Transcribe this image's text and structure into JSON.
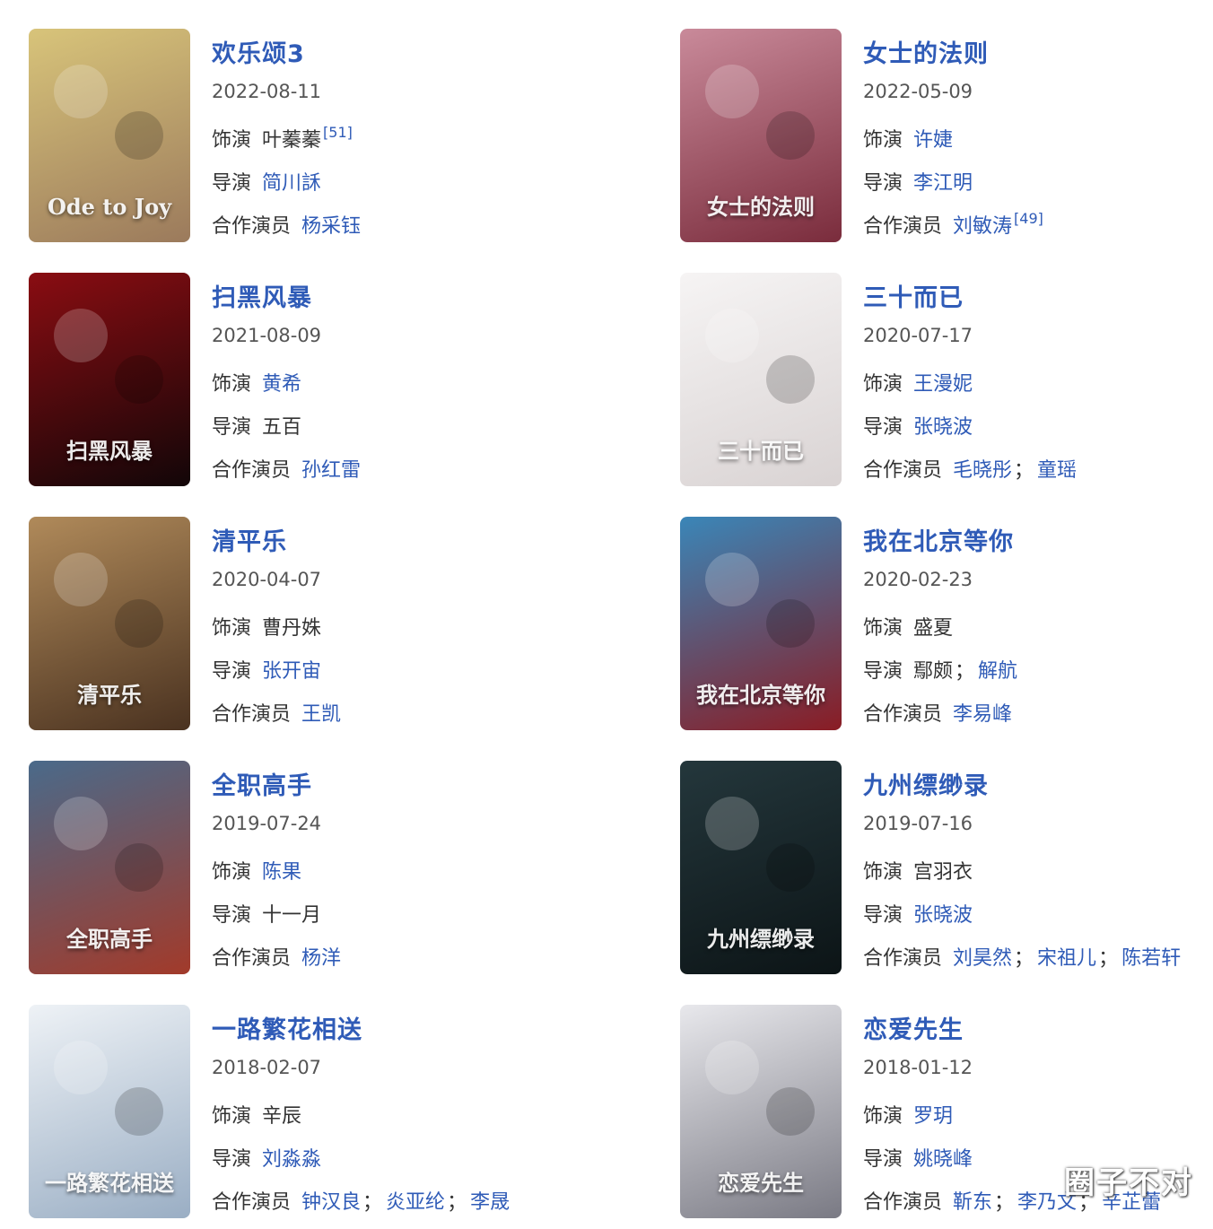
{
  "labels": {
    "role": "饰演",
    "director": "导演",
    "costars": "合作演员"
  },
  "watermark": "圈子不对",
  "cards": [
    {
      "title": "欢乐颂3",
      "date": "2022-08-11",
      "role": "叶蓁蓁",
      "role_ref": "[51]",
      "director": "简川訸",
      "costars": [
        "杨采钰"
      ],
      "poster_caption": "Ode to Joy",
      "colors": [
        "#d8c47a",
        "#9b7a5c"
      ]
    },
    {
      "title": "女士的法则",
      "date": "2022-05-09",
      "role": "许婕",
      "director": "李江明",
      "costars": [
        "刘敏涛"
      ],
      "costars_ref": "[49]",
      "poster_caption": "女士的法则",
      "colors": [
        "#c98a9a",
        "#7a2c3c"
      ]
    },
    {
      "title": "扫黑风暴",
      "date": "2021-08-09",
      "role": "黄希",
      "director": "五百",
      "costars": [
        "孙红雷"
      ],
      "poster_caption": "扫黑风暴",
      "colors": [
        "#8a0d12",
        "#120608"
      ]
    },
    {
      "title": "三十而已",
      "date": "2020-07-17",
      "role": "王漫妮",
      "director": "张晓波",
      "costars": [
        "毛晓彤",
        "童瑶"
      ],
      "poster_caption": "三十而已",
      "colors": [
        "#f6f4f4",
        "#d9d3d3"
      ]
    },
    {
      "title": "清平乐",
      "date": "2020-04-07",
      "role": "曹丹姝",
      "director": "张开宙",
      "costars": [
        "王凯"
      ],
      "poster_caption": "清平乐",
      "colors": [
        "#b08a5a",
        "#4a3220"
      ]
    },
    {
      "title": "我在北京等你",
      "date": "2020-02-23",
      "role": "盛夏",
      "director": "鄢颇",
      "director_extra": "解航",
      "costars": [
        "李易峰"
      ],
      "poster_caption": "我在北京等你",
      "colors": [
        "#3a86b8",
        "#8a1c24"
      ]
    },
    {
      "title": "全职高手",
      "date": "2019-07-24",
      "role": "陈果",
      "director": "十一月",
      "costars": [
        "杨洋"
      ],
      "poster_caption": "全职高手",
      "colors": [
        "#4a6a8a",
        "#a23a2a"
      ]
    },
    {
      "title": "九州缥缈录",
      "date": "2019-07-16",
      "role": "宫羽衣",
      "director": "张晓波",
      "costars": [
        "刘昊然",
        "宋祖儿",
        "陈若轩"
      ],
      "poster_caption": "九州缥缈录",
      "colors": [
        "#24373c",
        "#0c1416"
      ]
    },
    {
      "title": "一路繁花相送",
      "date": "2018-02-07",
      "role": "辛辰",
      "director": "刘淼淼",
      "costars": [
        "钟汉良",
        "炎亚纶",
        "李晟"
      ],
      "poster_caption": "一路繁花相送",
      "colors": [
        "#eef2f6",
        "#9aaec4"
      ]
    },
    {
      "title": "恋爱先生",
      "date": "2018-01-12",
      "role": "罗玥",
      "director": "姚晓峰",
      "costars": [
        "靳东",
        "李乃文",
        "辛芷蕾"
      ],
      "poster_caption": "恋爱先生",
      "colors": [
        "#e8e8ec",
        "#7a7a84"
      ]
    }
  ]
}
